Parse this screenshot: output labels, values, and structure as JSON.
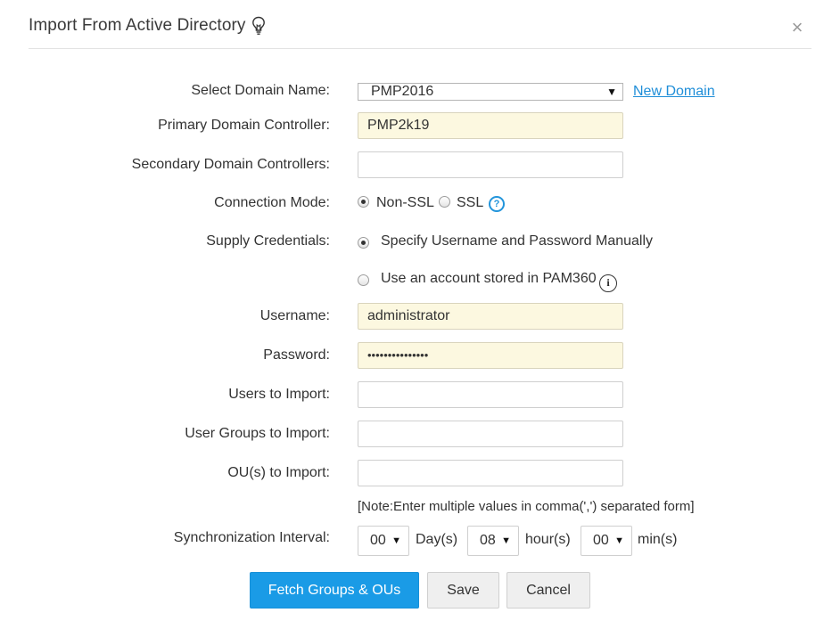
{
  "dialog": {
    "title": "Import From Active Directory",
    "close_glyph": "×"
  },
  "labels": {
    "select_domain": "Select Domain Name:",
    "primary_dc": "Primary Domain Controller:",
    "secondary_dc": "Secondary Domain Controllers:",
    "connection_mode": "Connection Mode:",
    "supply_credentials": "Supply Credentials:",
    "username": "Username:",
    "password": "Password:",
    "users_to_import": "Users to Import:",
    "user_groups_to_import": "User Groups to Import:",
    "ous_to_import": "OU(s) to Import:",
    "sync_interval": "Synchronization Interval:"
  },
  "domain": {
    "selected": "PMP2016",
    "new_domain_link": "New Domain"
  },
  "fields": {
    "primary_dc": "PMP2k19",
    "secondary_dc": "",
    "username": "administrator",
    "password": "•••••••••••••••",
    "users_to_import": "",
    "user_groups_to_import": "",
    "ous_to_import": ""
  },
  "connection_mode": {
    "options": [
      "Non-SSL",
      "SSL"
    ],
    "selected": "Non-SSL",
    "help_glyph": "?"
  },
  "credentials": {
    "option_manual": "Specify Username and Password Manually",
    "option_stored": "Use an account stored in PAM360",
    "selected": "manual",
    "info_glyph": "i"
  },
  "note": "[Note:Enter multiple values in comma(',') separated form]",
  "sync": {
    "day_value": "00",
    "day_unit": "Day(s)",
    "hour_value": "08",
    "hour_unit": "hour(s)",
    "min_value": "00",
    "min_unit": "min(s)",
    "arrow_glyph": "▼"
  },
  "buttons": {
    "fetch": "Fetch Groups & OUs",
    "save": "Save",
    "cancel": "Cancel"
  },
  "colors": {
    "accent": "#1a9be6",
    "link": "#1f8ed8",
    "filled_field": "#fcf8e0"
  }
}
